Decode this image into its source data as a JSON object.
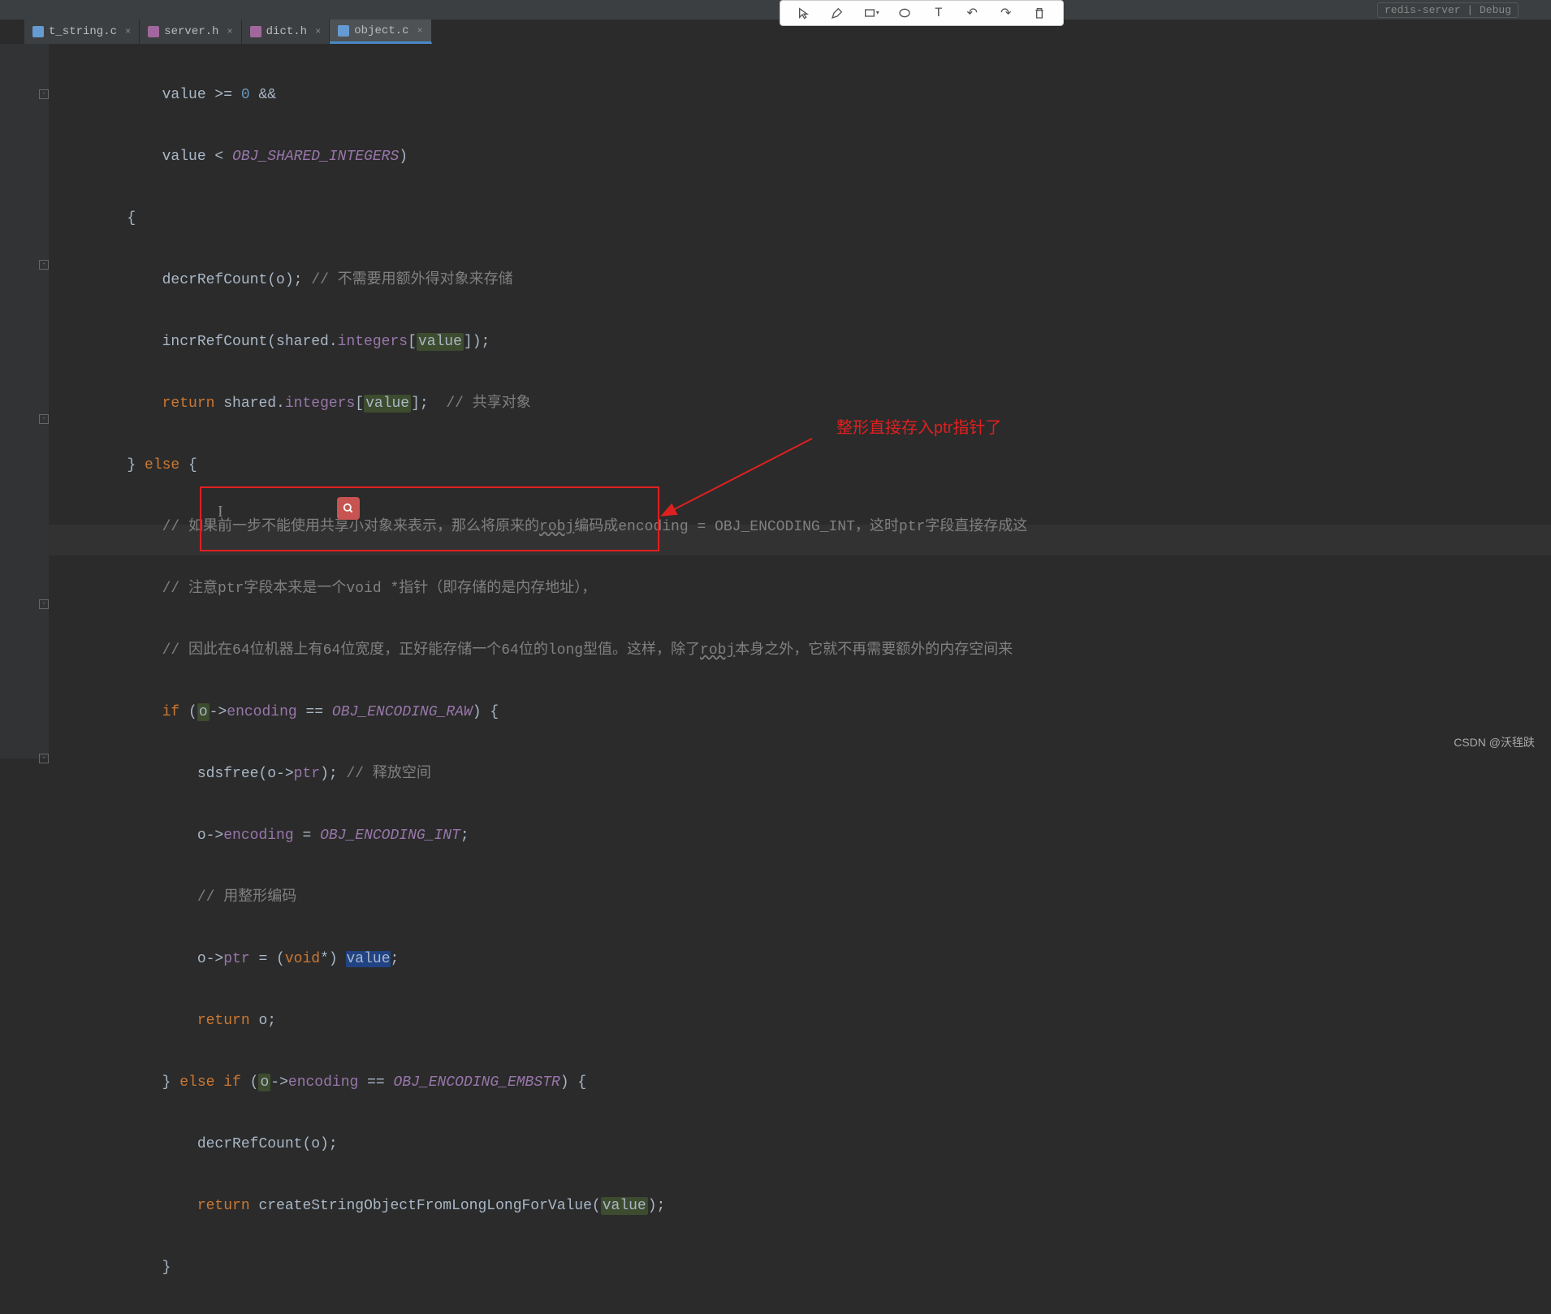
{
  "run_config": "redis-server | Debug",
  "tabs": [
    {
      "name": "t_string.c",
      "type": "c",
      "active": false
    },
    {
      "name": "server.h",
      "type": "h",
      "active": false
    },
    {
      "name": "dict.h",
      "type": "h",
      "active": false
    },
    {
      "name": "object.c",
      "type": "c",
      "active": true
    }
  ],
  "annotation_toolbar": {
    "tools": [
      "cursor",
      "pen",
      "rect",
      "oval",
      "text",
      "undo",
      "redo",
      "trash"
    ]
  },
  "annotations": {
    "label_text": "整形直接存入ptr指针了"
  },
  "code": {
    "l1_a": "            value >= ",
    "l1_b": "0",
    "l1_c": " &&",
    "l2_a": "            value < ",
    "l2_b": "OBJ_SHARED_INTEGERS",
    "l2_c": ")",
    "l3": "        {",
    "l4_a": "            decrRefCount(o); ",
    "l4_b": "// 不需要用额外得对象来存储",
    "l5_a": "            incrRefCount(shared.",
    "l5_b": "integers",
    "l5_c": "[",
    "l5_d": "value",
    "l5_e": "]);",
    "l6_a": "            ",
    "l6_b": "return",
    "l6_c": " shared.",
    "l6_d": "integers",
    "l6_e": "[",
    "l6_f": "value",
    "l6_g": "];  ",
    "l6_h": "// 共享对象",
    "l7_a": "        } ",
    "l7_b": "else",
    "l7_c": " {",
    "l8_a": "            ",
    "l8_b": "// 如果前一步不能使用共享小对象来表示，那么将原来的",
    "l8_c": "robj",
    "l8_d": "编码成encoding = OBJ_ENCODING_INT，这时ptr字段直接存成这",
    "l9_a": "            ",
    "l9_b": "// 注意ptr字段本来是一个void *指针（即存储的是内存地址），",
    "l10_a": "            ",
    "l10_b": "// 因此在64位机器上有64位宽度，正好能存储一个64位的long型值。这样，除了",
    "l10_c": "robj",
    "l10_d": "本身之外，它就不再需要额外的内存空间来",
    "l11_a": "            ",
    "l11_b": "if",
    "l11_c": " (",
    "l11_d": "o",
    "l11_e": "->",
    "l11_f": "encoding",
    "l11_g": " == ",
    "l11_h": "OBJ_ENCODING_RAW",
    "l11_i": ") {",
    "l12_a": "                sdsfree(o->",
    "l12_b": "ptr",
    "l12_c": "); ",
    "l12_d": "// 释放空间",
    "l13_a": "                o->",
    "l13_b": "encoding",
    "l13_c": " = ",
    "l13_d": "OBJ_ENCODING_INT",
    "l13_e": ";",
    "l14_a": "                ",
    "l14_b": "// 用整形编码",
    "l15_a": "                o->",
    "l15_b": "ptr",
    "l15_c": " = (",
    "l15_d": "void",
    "l15_e": "*) ",
    "l15_f": "value",
    "l15_g": ";",
    "l16_a": "                ",
    "l16_b": "return",
    "l16_c": " o;",
    "l17_a": "            } ",
    "l17_b": "else if",
    "l17_c": " (",
    "l17_d": "o",
    "l17_e": "->",
    "l17_f": "encoding",
    "l17_g": " == ",
    "l17_h": "OBJ_ENCODING_EMBSTR",
    "l17_i": ") {",
    "l18": "                decrRefCount(o);",
    "l19_a": "                ",
    "l19_b": "return",
    "l19_c": " createStringObjectFromLongLongForValue(",
    "l19_d": "value",
    "l19_e": ");",
    "l20": "            }"
  },
  "watermark": "CSDN @沃毪趺"
}
